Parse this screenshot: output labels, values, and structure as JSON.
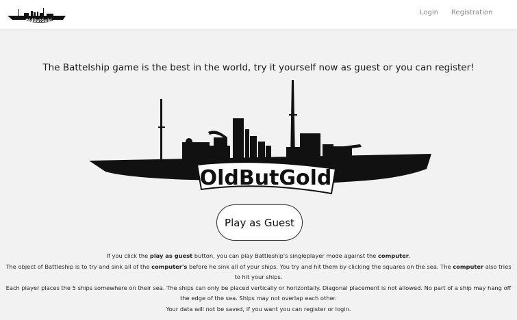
{
  "nav": {
    "logo_text": "OldButGold",
    "login_label": "Login",
    "registration_label": "Registration"
  },
  "hero": {
    "tagline": "The Battelship game is the best in the world, try it yourself now as guest or you can register!",
    "logo_text": "OldButGold",
    "ship_icon": "battleship-icon"
  },
  "guest_button_label": "Play as Guest",
  "info": {
    "line1": {
      "a": "If you click the ",
      "b": "play as guest",
      "c": " button, you can play Battleship's singleplayer mode against the ",
      "d": "computer",
      "e": "."
    },
    "line2": {
      "a": "The object of Battleship is to try and sink all of the ",
      "b": "computer's",
      "c": " before he sink all of your ships. You try and hit them by clicking the squares on the sea. The ",
      "d": "computer",
      "e": " also tries to hit your ships."
    },
    "line3": "Each player places the 5 ships somewhere on their sea. The ships can only be placed vertically or horizontally. Diagonal placement is not allowed. No part of a ship may hang off the edge of the sea. Ships may not overlap each other.",
    "line4": "Your data will not be saved, if you want you can register or login."
  },
  "colors": {
    "background": "#f2f2f2",
    "navbar": "#ffffff",
    "ship": "#111111",
    "nav_link": "#8a8a8a"
  }
}
